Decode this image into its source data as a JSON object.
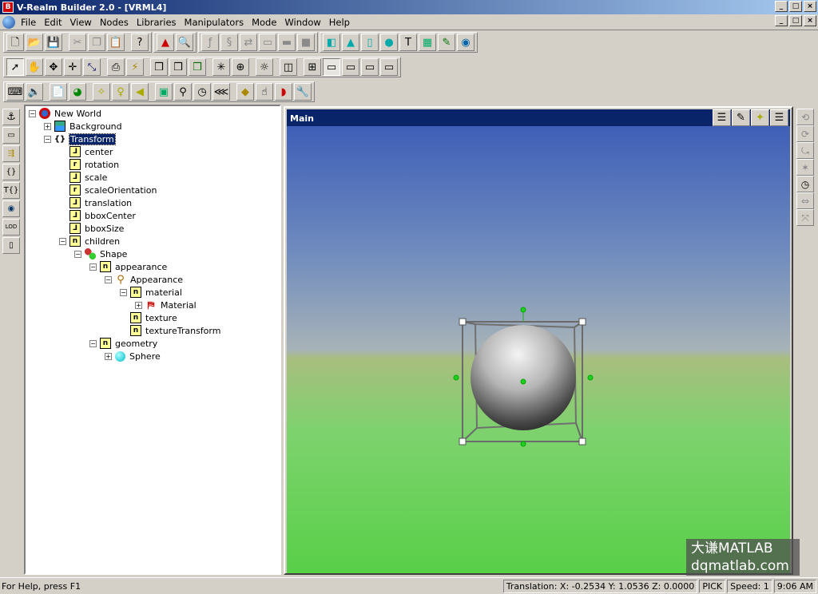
{
  "title": "V-Realm Builder 2.0 - [VRML4]",
  "menu": [
    "File",
    "Edit",
    "View",
    "Nodes",
    "Libraries",
    "Manipulators",
    "Mode",
    "Window",
    "Help"
  ],
  "menu_hotkeys": [
    "F",
    "E",
    "V",
    "N",
    "L",
    "M",
    "M",
    "W",
    "H"
  ],
  "window_controls": {
    "minimize": "_",
    "restore": "□",
    "close": "×"
  },
  "toolbar1": [
    "new-icon",
    "open-icon",
    "save-icon",
    "cut-icon",
    "copy-icon",
    "paste-icon",
    "help-icon",
    "shapes-icon",
    "find-icon",
    "function-icon",
    "script-icon",
    "transform-icon",
    "box-grey-icon",
    "box-dark-icon",
    "box-icon",
    "cone-icon",
    "cylinder-icon",
    "sphere-icon",
    "text-icon",
    "grid-icon",
    "paint-icon",
    "world-icon"
  ],
  "toolbar2": [
    "pointer-icon",
    "hand-icon",
    "move-icon",
    "move-xy-icon",
    "scale-icon",
    "print-icon",
    "lightning-icon",
    "window-a-icon",
    "window-b-icon",
    "window-c-icon",
    "snowflake-icon",
    "globe-icon",
    "lightbulb-icon",
    "single-view-icon",
    "quad-view-icon",
    "view-one-icon",
    "view-two-icon",
    "view-three-icon",
    "view-four-icon"
  ],
  "toolbar3": [
    "keyboard-icon",
    "sound-icon",
    "document-icon",
    "globe2-icon",
    "spotlight-icon",
    "pointlight-icon",
    "directional-icon",
    "image-icon",
    "navigation-icon",
    "time-icon",
    "touch-icon",
    "proximity-icon",
    "hand-sensor-icon",
    "cylinder-sensor-icon",
    "wrench-icon"
  ],
  "left_tools": [
    "anchor-icon",
    "billboard-icon",
    "collision-icon",
    "group-icon",
    "transform-node-icon",
    "inline-icon",
    "lod-icon",
    "switch-icon"
  ],
  "right_tools": [
    "rotate-x-icon",
    "rotate-y-icon",
    "rotate-z-icon",
    "center-icon",
    "timer-icon",
    "scale-axis-icon",
    "fit-icon"
  ],
  "tree": {
    "nodes": [
      {
        "label": "New World",
        "icon": "world"
      },
      {
        "label": "Background",
        "icon": "bg"
      },
      {
        "label": "Transform",
        "icon": "tr",
        "selected": true
      },
      {
        "label": "center",
        "icon": "field",
        "glyph": "⅃"
      },
      {
        "label": "rotation",
        "icon": "field",
        "glyph": "r"
      },
      {
        "label": "scale",
        "icon": "field",
        "glyph": "⅃"
      },
      {
        "label": "scaleOrientation",
        "icon": "field",
        "glyph": "r"
      },
      {
        "label": "translation",
        "icon": "field",
        "glyph": "⅃"
      },
      {
        "label": "bboxCenter",
        "icon": "field",
        "glyph": "⅃"
      },
      {
        "label": "bboxSize",
        "icon": "field",
        "glyph": "⅃"
      },
      {
        "label": "children",
        "icon": "field",
        "glyph": "n"
      },
      {
        "label": "Shape",
        "icon": "shape"
      },
      {
        "label": "appearance",
        "icon": "field",
        "glyph": "n"
      },
      {
        "label": "Appearance",
        "icon": "app"
      },
      {
        "label": "material",
        "icon": "field",
        "glyph": "n"
      },
      {
        "label": "Material",
        "icon": "mat"
      },
      {
        "label": "texture",
        "icon": "field",
        "glyph": "n"
      },
      {
        "label": "textureTransform",
        "icon": "field",
        "glyph": "n"
      },
      {
        "label": "geometry",
        "icon": "field",
        "glyph": "n"
      },
      {
        "label": "Sphere",
        "icon": "sph"
      }
    ]
  },
  "view": {
    "title": "Main",
    "buttons": [
      "tree-view-icon",
      "pencil-icon",
      "light-view-icon",
      "tree-view2-icon"
    ]
  },
  "watermark": {
    "line1": "大谦MATLAB",
    "line2": "dqmatlab.com"
  },
  "status": {
    "help": "For Help, press F1",
    "translation": "Translation: X: -0.2534  Y: 1.0536  Z: 0.0000",
    "mode": "PICK",
    "speed": "Speed: 1",
    "time": "9:06 AM"
  }
}
